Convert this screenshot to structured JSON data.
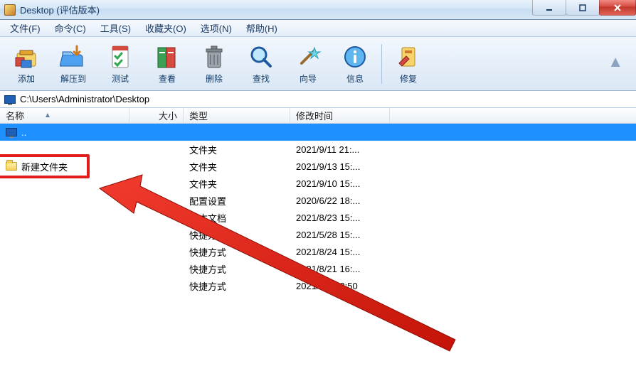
{
  "titlebar": {
    "title": "Desktop (评估版本)"
  },
  "menu": {
    "items": [
      {
        "label": "文件(F)"
      },
      {
        "label": "命令(C)"
      },
      {
        "label": "工具(S)"
      },
      {
        "label": "收藏夹(O)"
      },
      {
        "label": "选项(N)"
      },
      {
        "label": "帮助(H)"
      }
    ]
  },
  "toolbar": {
    "buttons": [
      {
        "label": "添加",
        "icon": "add"
      },
      {
        "label": "解压到",
        "icon": "extract"
      },
      {
        "label": "测试",
        "icon": "test"
      },
      {
        "label": "查看",
        "icon": "view"
      },
      {
        "label": "删除",
        "icon": "delete"
      },
      {
        "label": "查找",
        "icon": "find"
      },
      {
        "label": "向导",
        "icon": "wizard"
      },
      {
        "label": "信息",
        "icon": "info"
      },
      {
        "label": "修复",
        "icon": "repair"
      }
    ]
  },
  "address": {
    "path": "C:\\Users\\Administrator\\Desktop"
  },
  "columns": {
    "name": "名称",
    "size": "大小",
    "type": "类型",
    "date": "修改时间"
  },
  "rows": [
    {
      "name": "..",
      "type": "",
      "date": "",
      "icon": "monitor",
      "selected": true
    },
    {
      "name": "",
      "type": "文件夹",
      "date": "2021/9/11 21:...",
      "icon": "none"
    },
    {
      "name": "新建文件夹",
      "type": "文件夹",
      "date": "2021/9/13 15:...",
      "icon": "folder",
      "highlighted": true
    },
    {
      "name": "",
      "type": "文件夹",
      "date": "2021/9/10 15:...",
      "icon": "none"
    },
    {
      "name": "",
      "type": "配置设置",
      "date": "2020/6/22 18:...",
      "icon": "none"
    },
    {
      "name": "",
      "type": "文本文档",
      "date": "2021/8/23 15:...",
      "icon": "none"
    },
    {
      "name": "",
      "type": "快捷方式",
      "date": "2021/5/28 15:...",
      "icon": "none"
    },
    {
      "name": "",
      "type": "快捷方式",
      "date": "2021/8/24 15:...",
      "icon": "none"
    },
    {
      "name": "",
      "type": "快捷方式",
      "date": "2021/8/21 16:...",
      "icon": "none"
    },
    {
      "name": "",
      "type": "快捷方式",
      "date": "2021/8/6 13:50",
      "icon": "none"
    }
  ]
}
